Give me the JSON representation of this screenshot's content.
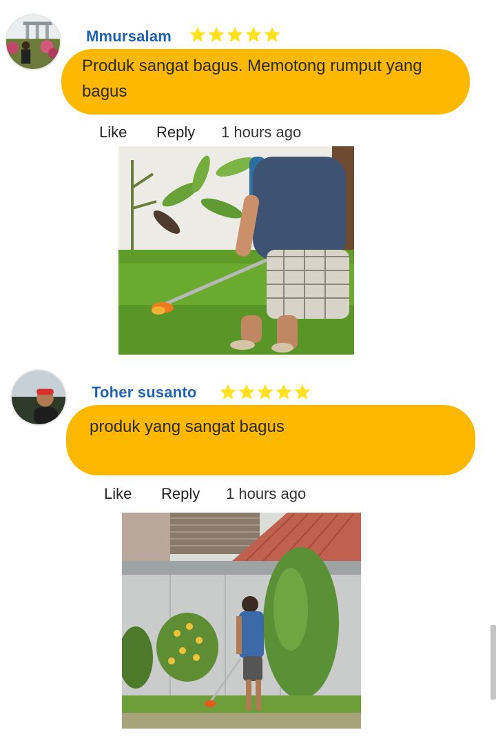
{
  "comments": [
    {
      "author": "Mmursalam",
      "rating": 5,
      "text": "Produk sangat bagus. Memotong rumput yang bagus",
      "actions": {
        "like": "Like",
        "reply": "Reply",
        "time": "1 hours ago"
      }
    },
    {
      "author": "Toher susanto",
      "rating": 5,
      "text": "produk yang sangat bagus",
      "actions": {
        "like": "Like",
        "reply": "Reply",
        "time": "1 hours ago"
      }
    }
  ],
  "colors": {
    "bubble": "#ffb800",
    "username": "#1f62b0",
    "star": "#ffe11f"
  },
  "icons": [
    "star-icon"
  ]
}
